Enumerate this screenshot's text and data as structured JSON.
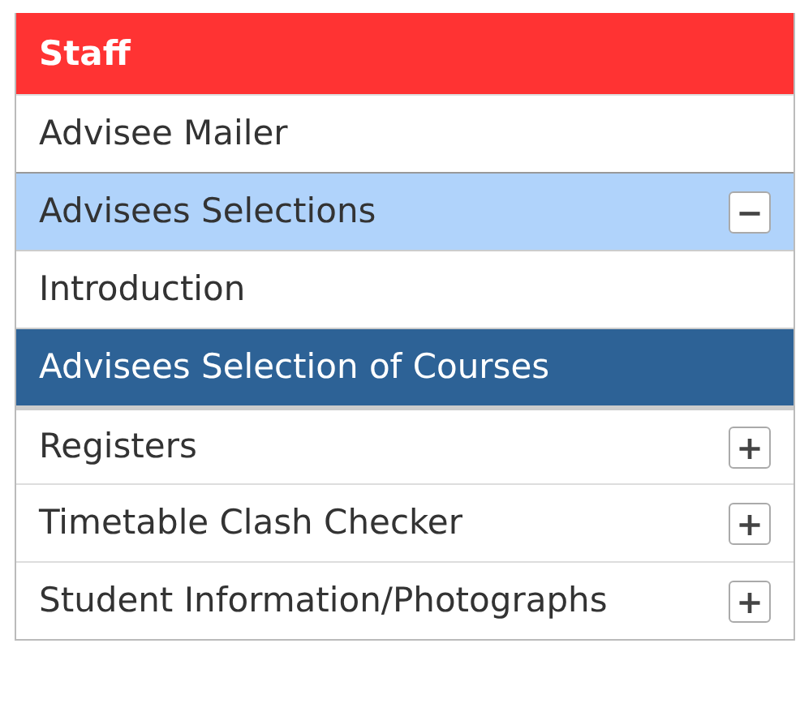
{
  "header": "Staff",
  "menu": [
    {
      "label": "Advisee Mailer",
      "selected": false
    },
    {
      "label": "Advisees Selections",
      "selected": false,
      "expanded": true,
      "toggle": "−",
      "children": [
        {
          "label": "Introduction",
          "selected": false
        },
        {
          "label": "Advisees Selection of Courses",
          "selected": true
        }
      ]
    },
    {
      "label": "Registers",
      "selected": false,
      "expanded": false,
      "toggle": "+"
    },
    {
      "label": "Timetable Clash Checker",
      "selected": false,
      "expanded": false,
      "toggle": "+"
    },
    {
      "label": "Student Information/Photographs",
      "selected": false,
      "expanded": false,
      "toggle": "+"
    }
  ]
}
